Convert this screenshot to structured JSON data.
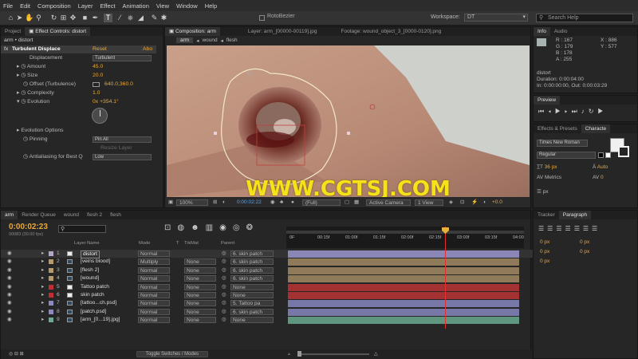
{
  "menu": [
    "File",
    "Edit",
    "Composition",
    "Layer",
    "Effect",
    "Animation",
    "View",
    "Window",
    "Help"
  ],
  "toolbar": {
    "rotobezier": "RotoBezier",
    "workspace_label": "Workspace:",
    "workspace_value": "DT",
    "search_placeholder": "Search Help"
  },
  "left_tabs": {
    "project": "Project",
    "effect_controls": "Effect Controls: distort"
  },
  "effect_controls": {
    "layer_path": "arm • distort",
    "effect_name": "Turbulent Displace",
    "reset": "Reset",
    "about": "Abo",
    "props": [
      {
        "label": "Displacement",
        "value": "Turbulent"
      },
      {
        "label": "Amount",
        "value": "45.0"
      },
      {
        "label": "Size",
        "value": "20.0"
      },
      {
        "label": "Offset (Turbulence)",
        "value": "640.0,360.0"
      },
      {
        "label": "Complexity",
        "value": "1.0"
      },
      {
        "label": "Evolution",
        "value": "0x +354.1°"
      },
      {
        "label": "Evolution Options",
        "value": ""
      },
      {
        "label": "Pinning",
        "value": "Pin All"
      },
      {
        "label": "",
        "value": "Resize Layer"
      },
      {
        "label": "Antialiasing for Best Q",
        "value": "Low"
      }
    ]
  },
  "viewer_tabs": {
    "composition": "Composition: arm",
    "layer": "Layer: arm_[00000-00119].jpg",
    "footage": "Footage: wound_object_3_[0000-0120].png"
  },
  "breadcrumbs": [
    "arm",
    "wound",
    "flesh"
  ],
  "watermark": "WWW.CGTSJ.COM",
  "viewer_footer": {
    "zoom": "100%",
    "time": "0:00:02:22",
    "resolution": "(Full)",
    "camera": "Active Camera",
    "view": "1 View",
    "offset": "+0.0"
  },
  "info": {
    "tab": "Info",
    "tab2": "Audio",
    "r": "R : 167",
    "g": "G : 179",
    "b": "B : 178",
    "a": "A : 255",
    "x": "X : 886",
    "y": "Y : 577",
    "name": "distort",
    "duration": "Duration: 0:00:04:00",
    "inout": "In: 0:00:00:00, Out: 0:00:03:29"
  },
  "preview": {
    "tab": "Preview"
  },
  "effects_presets": {
    "tab": "Effects & Presets",
    "tab2": "Characte"
  },
  "character": {
    "font": "Times New Roman",
    "style": "Regular",
    "size": "36 px",
    "leading": "Auto",
    "tracking_label": "Metrics",
    "tracking": "0",
    "size_unit": "px"
  },
  "timeline_tabs": [
    "arm",
    "Render Queue",
    "wound",
    "flesh 2",
    "flesh"
  ],
  "timeline": {
    "timecode": "0:00:02:23",
    "fps": "00083 (30.00 fps)",
    "headers": {
      "layer_name": "Layer Name",
      "mode": "Mode",
      "t": "T",
      "trkmat": "TrkMat",
      "parent": "Parent"
    },
    "ruler": [
      "0F",
      "00:15f",
      "01:00f",
      "01:15f",
      "02:00f",
      "02:15f",
      "03:00f",
      "03:15f",
      "04:00"
    ],
    "layers": [
      {
        "num": "1",
        "name": "distort",
        "mode": "Normal",
        "trk": "",
        "parent": "6. skin patch",
        "color": "#b6a7c9",
        "bar": "#8a86b6"
      },
      {
        "num": "2",
        "name": "[veins blood]",
        "mode": "Multiply",
        "trk": "None",
        "parent": "6. skin patch",
        "color": "#b59a6a",
        "bar": "#8f7a5a"
      },
      {
        "num": "3",
        "name": "[flesh 2]",
        "mode": "Normal",
        "trk": "None",
        "parent": "6. skin patch",
        "color": "#b59a6a",
        "bar": "#8f7a5a"
      },
      {
        "num": "4",
        "name": "[wound]",
        "mode": "Normal",
        "trk": "None",
        "parent": "6. skin patch",
        "color": "#b59a6a",
        "bar": "#8f7a5a"
      },
      {
        "num": "5",
        "name": "Tattoo patch",
        "mode": "Normal",
        "trk": "None",
        "parent": "None",
        "color": "#c03030",
        "bar": "#a53232"
      },
      {
        "num": "6",
        "name": "skin patch",
        "mode": "Normal",
        "trk": "None",
        "parent": "None",
        "color": "#c03030",
        "bar": "#a53232"
      },
      {
        "num": "7",
        "name": "[tattoo...ch.psd]",
        "mode": "Normal",
        "trk": "None",
        "parent": "5. Tattoo pa",
        "color": "#8a8ac0",
        "bar": "#7777a8"
      },
      {
        "num": "8",
        "name": "[patch.psd]",
        "mode": "Normal",
        "trk": "None",
        "parent": "6. skin patch",
        "color": "#8a8ac0",
        "bar": "#7777a8"
      },
      {
        "num": "9",
        "name": "[arm_[0...19].jpg]",
        "mode": "Normal",
        "trk": "None",
        "parent": "None",
        "color": "#6ea890",
        "bar": "#5f9680"
      }
    ],
    "toggle": "Toggle Switches / Modes"
  },
  "right_bottom": {
    "tab": "Tracker",
    "tab2": "Paragraph",
    "px": "0 px"
  }
}
